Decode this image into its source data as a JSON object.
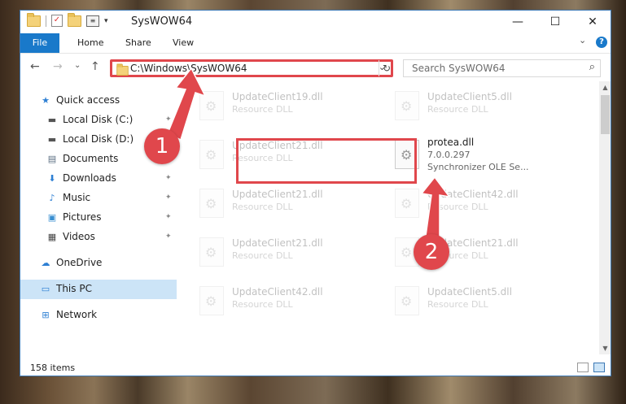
{
  "window": {
    "title": "SysWOW64",
    "minimize_glyph": "—",
    "maximize_glyph": "☐",
    "close_glyph": "✕"
  },
  "ribbon": {
    "tabs": [
      "File",
      "Home",
      "Share",
      "View"
    ],
    "expand_glyph": "⌄",
    "help_glyph": "?"
  },
  "nav": {
    "back_glyph": "←",
    "forward_glyph": "→",
    "recent_glyph": "⌄",
    "up_glyph": "↑"
  },
  "address": {
    "path": "C:\\Windows\\SysWOW64",
    "dropdown_glyph": "⌄",
    "refresh_glyph": "↻"
  },
  "search": {
    "placeholder": "Search SysWOW64",
    "icon_glyph": "⌕"
  },
  "sidebar": {
    "items": [
      {
        "label": "Quick access",
        "icon": "star-icon",
        "glyph": "★",
        "color": "#2d7fd3",
        "pinned": false
      },
      {
        "label": "Local Disk (C:)",
        "icon": "drive-icon",
        "glyph": "▬",
        "color": "#555555",
        "pinned": true
      },
      {
        "label": "Local Disk (D:)",
        "icon": "drive-icon",
        "glyph": "▬",
        "color": "#555555",
        "pinned": true
      },
      {
        "label": "Documents",
        "icon": "documents-icon",
        "glyph": "▤",
        "color": "#5a6d82",
        "pinned": true
      },
      {
        "label": "Downloads",
        "icon": "download-icon",
        "glyph": "⬇",
        "color": "#2d7fd3",
        "pinned": true
      },
      {
        "label": "Music",
        "icon": "music-icon",
        "glyph": "♪",
        "color": "#2d7fd3",
        "pinned": true
      },
      {
        "label": "Pictures",
        "icon": "pictures-icon",
        "glyph": "▣",
        "color": "#3a8fd1",
        "pinned": true
      },
      {
        "label": "Videos",
        "icon": "videos-icon",
        "glyph": "▦",
        "color": "#444444",
        "pinned": true
      },
      {
        "label": "OneDrive",
        "icon": "cloud-icon",
        "glyph": "☁",
        "color": "#2d7fd3",
        "pinned": false
      },
      {
        "label": "This PC",
        "icon": "computer-icon",
        "glyph": "▭",
        "color": "#2d7fd3",
        "pinned": false,
        "selected": true
      },
      {
        "label": "Network",
        "icon": "network-icon",
        "glyph": "⊞",
        "color": "#2d7fd3",
        "pinned": false
      }
    ],
    "pin_glyph": "📌"
  },
  "files": {
    "faded": [
      {
        "name": "UpdateClient19.dll",
        "desc": "Resource DLL"
      },
      {
        "name": "UpdateClient5.dll",
        "desc": "Resource DLL"
      },
      {
        "name": "UpdateClient21.dll",
        "desc": "Resource DLL"
      },
      {
        "name": "UpdateClient21.dll",
        "desc": "Resource DLL"
      },
      {
        "name": "UpdateClient42.dll",
        "desc": "Resource DLL"
      },
      {
        "name": "UpdateClient21.dll",
        "desc": "Resource DLL"
      },
      {
        "name": "UpdateClient21.dll",
        "desc": "Resource DLL"
      },
      {
        "name": "UpdateClient42.dll",
        "desc": "Resource DLL"
      },
      {
        "name": "UpdateClient5.dll",
        "desc": "Resource DLL"
      }
    ],
    "highlighted": {
      "name": "protea.dll",
      "version": "7.0.0.297",
      "desc": "Synchronizer OLE Se..."
    }
  },
  "status": {
    "item_count": "158 items"
  },
  "annotations": {
    "step1": "1",
    "step2": "2",
    "color": "#e0474c"
  },
  "scrollbar": {
    "up_glyph": "▲",
    "down_glyph": "▼"
  }
}
